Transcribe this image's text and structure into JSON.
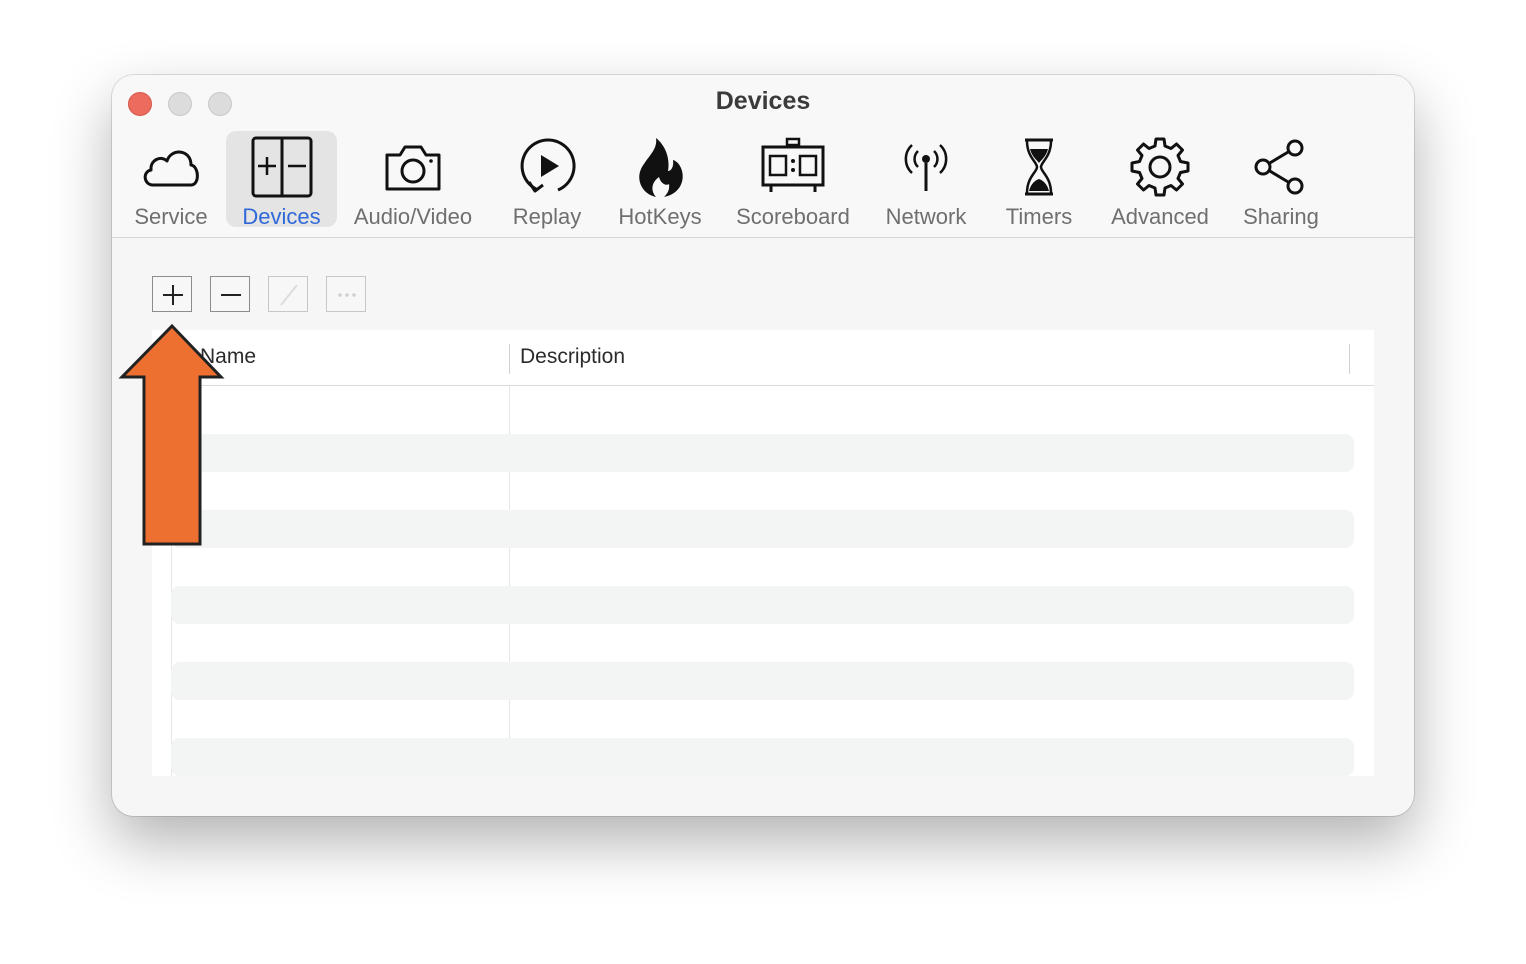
{
  "window": {
    "title": "Devices"
  },
  "toolbar": {
    "tabs": [
      {
        "label": "Service",
        "icon": "cloud-icon"
      },
      {
        "label": "Devices",
        "icon": "devices-plus-minus-icon",
        "selected": true
      },
      {
        "label": "Audio/Video",
        "icon": "camera-icon"
      },
      {
        "label": "Replay",
        "icon": "replay-icon"
      },
      {
        "label": "HotKeys",
        "icon": "flame-icon"
      },
      {
        "label": "Scoreboard",
        "icon": "scoreboard-icon"
      },
      {
        "label": "Network",
        "icon": "antenna-icon"
      },
      {
        "label": "Timers",
        "icon": "hourglass-icon"
      },
      {
        "label": "Advanced",
        "icon": "gear-icon"
      },
      {
        "label": "Sharing",
        "icon": "share-icon"
      }
    ],
    "accent_color": "#2f68d8"
  },
  "list_controls": {
    "add": "add-icon",
    "remove": "remove-icon",
    "edit": "edit-icon",
    "more": "more-icon"
  },
  "table": {
    "columns": [
      "Name",
      "Description"
    ],
    "rows": []
  },
  "annotation": {
    "arrow_color": "#ee7030",
    "arrow_icon": "arrow-up-icon"
  }
}
